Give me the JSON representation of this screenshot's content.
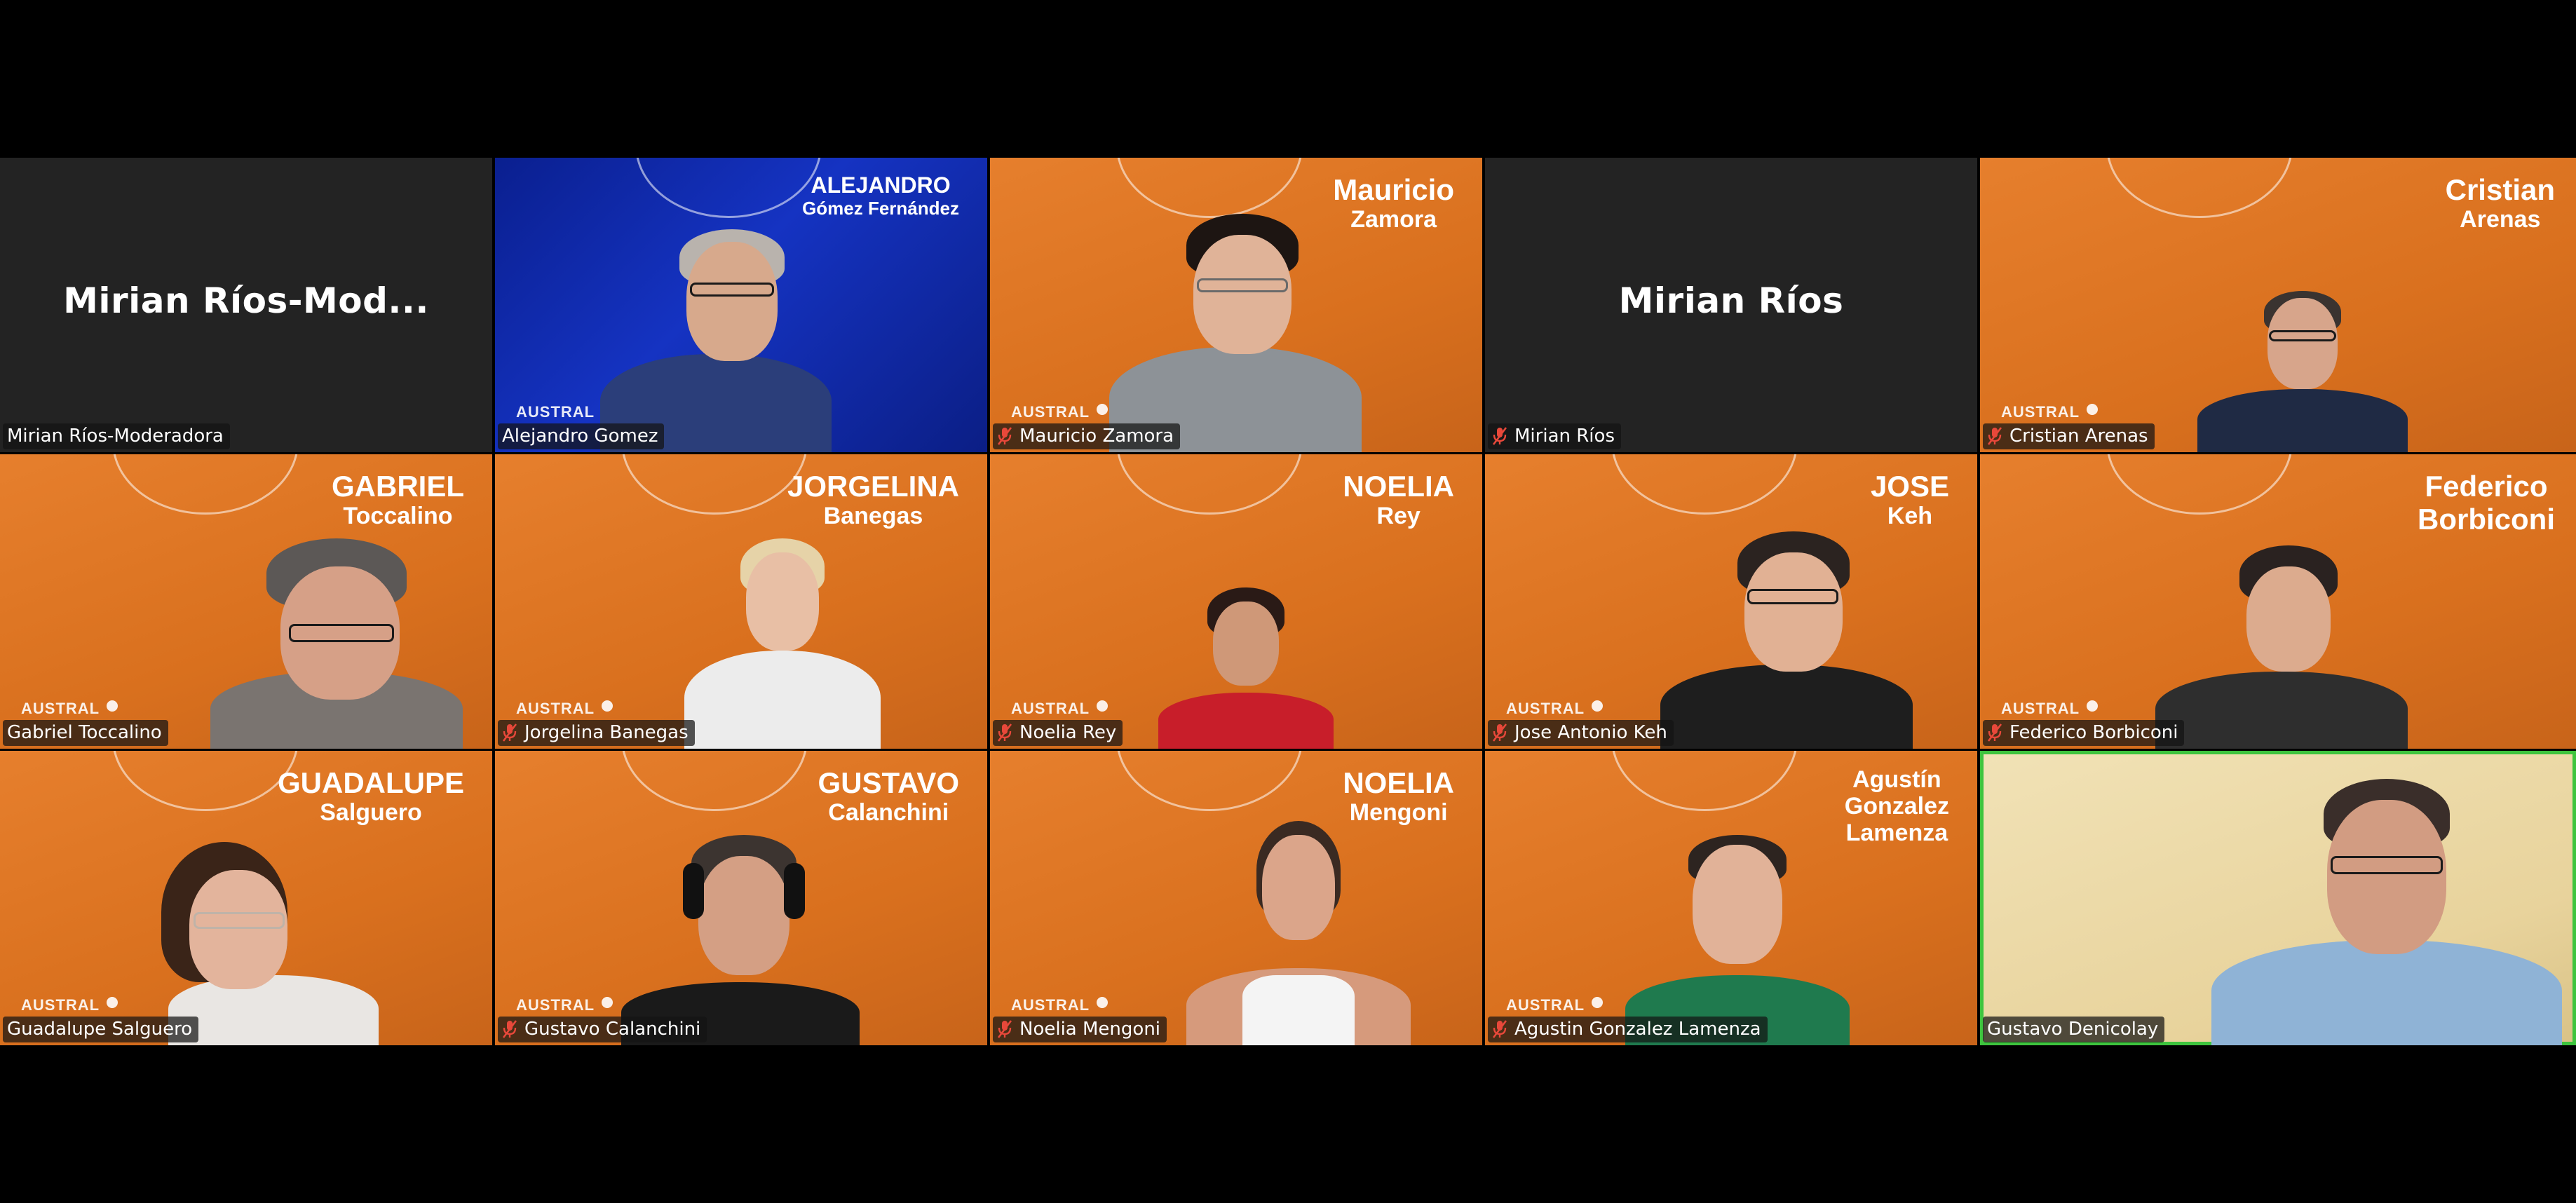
{
  "colors": {
    "background": "#000000",
    "tile_dark": "#232323",
    "tile_orange": "#e07828",
    "active_speaker_border": "#3ec43e",
    "muted_icon": "#e8483a"
  },
  "participants": [
    {
      "label": "Mirian Ríos-Moderadora",
      "tile_name": "Mirian Ríos-Mod...",
      "muted": false,
      "video": false
    },
    {
      "label": "Alejandro Gomez",
      "banner1": "ALEJANDRO",
      "banner2": "Gómez Fernández",
      "austral": "AUSTRAL",
      "muted": false,
      "video": true
    },
    {
      "label": "Mauricio Zamora",
      "banner1": "Mauricio",
      "banner2": "Zamora",
      "austral": "AUSTRAL",
      "muted": true,
      "video": true
    },
    {
      "label": "Mirian Ríos",
      "tile_name": "Mirian Ríos",
      "muted": true,
      "video": false
    },
    {
      "label": "Cristian Arenas",
      "banner1": "Cristian",
      "banner2": "Arenas",
      "austral": "AUSTRAL",
      "muted": true,
      "video": true
    },
    {
      "label": "Gabriel Toccalino",
      "banner1": "GABRIEL",
      "banner2": "Toccalino",
      "austral": "AUSTRAL",
      "muted": false,
      "video": true
    },
    {
      "label": "Jorgelina Banegas",
      "banner1": "JORGELINA",
      "banner2": "Banegas",
      "austral": "AUSTRAL",
      "muted": true,
      "video": true
    },
    {
      "label": "Noelia Rey",
      "banner1": "NOELIA",
      "banner2": "Rey",
      "austral": "AUSTRAL",
      "muted": true,
      "video": true
    },
    {
      "label": "Jose Antonio Keh",
      "banner1": "JOSE",
      "banner2": "Keh",
      "austral": "AUSTRAL",
      "muted": true,
      "video": true
    },
    {
      "label": "Federico Borbiconi",
      "banner1": "Federico",
      "banner2": "Borbiconi",
      "austral": "AUSTRAL",
      "muted": true,
      "video": true
    },
    {
      "label": "Guadalupe Salguero",
      "banner1": "GUADALUPE",
      "banner2": "Salguero",
      "austral": "AUSTRAL",
      "muted": false,
      "video": true
    },
    {
      "label": "Gustavo Calanchini",
      "banner1": "GUSTAVO",
      "banner2": "Calanchini",
      "austral": "AUSTRAL",
      "muted": true,
      "video": true
    },
    {
      "label": "Noelia Mengoni",
      "banner1": "NOELIA",
      "banner2": "Mengoni",
      "austral": "AUSTRAL",
      "muted": true,
      "video": true
    },
    {
      "label": "Agustin Gonzalez Lamenza",
      "banner1": "Agustín",
      "banner2": "Gonzalez",
      "banner3": "Lamenza",
      "austral": "AUSTRAL",
      "muted": true,
      "video": true
    },
    {
      "label": "Gustavo Denicolay",
      "muted": false,
      "video": true,
      "active_speaker": true
    }
  ]
}
